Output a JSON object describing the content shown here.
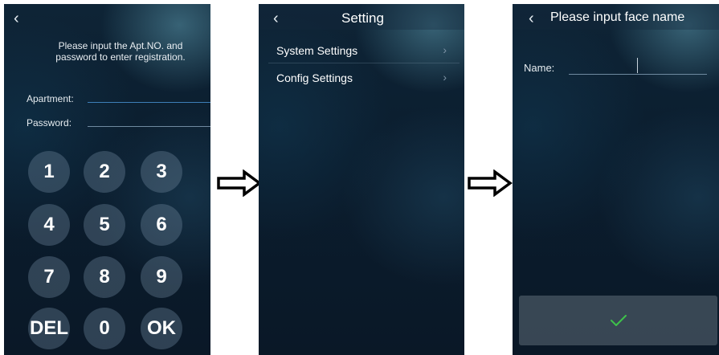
{
  "screen1": {
    "back_icon": "chevron-left-icon",
    "instruction_line1": "Please input the Apt.NO. and",
    "instruction_line2": "password to enter registration.",
    "apartment_label": "Apartment:",
    "password_label": "Password:",
    "keys": [
      "1",
      "2",
      "3",
      "4",
      "5",
      "6",
      "7",
      "8",
      "9",
      "DEL",
      "0",
      "OK"
    ]
  },
  "screen2": {
    "back_icon": "chevron-left-icon",
    "title": "Setting",
    "menu": [
      {
        "label": "System Settings",
        "icon": "chevron-right-icon"
      },
      {
        "label": "Config Settings",
        "icon": "chevron-right-icon"
      }
    ]
  },
  "screen3": {
    "back_icon": "chevron-left-icon",
    "title": "Please input face name",
    "name_label": "Name:",
    "name_value": "",
    "confirm_icon": "checkmark-icon",
    "confirm_color": "#3ec24a"
  },
  "arrows": {
    "icon": "right-arrow-icon"
  }
}
